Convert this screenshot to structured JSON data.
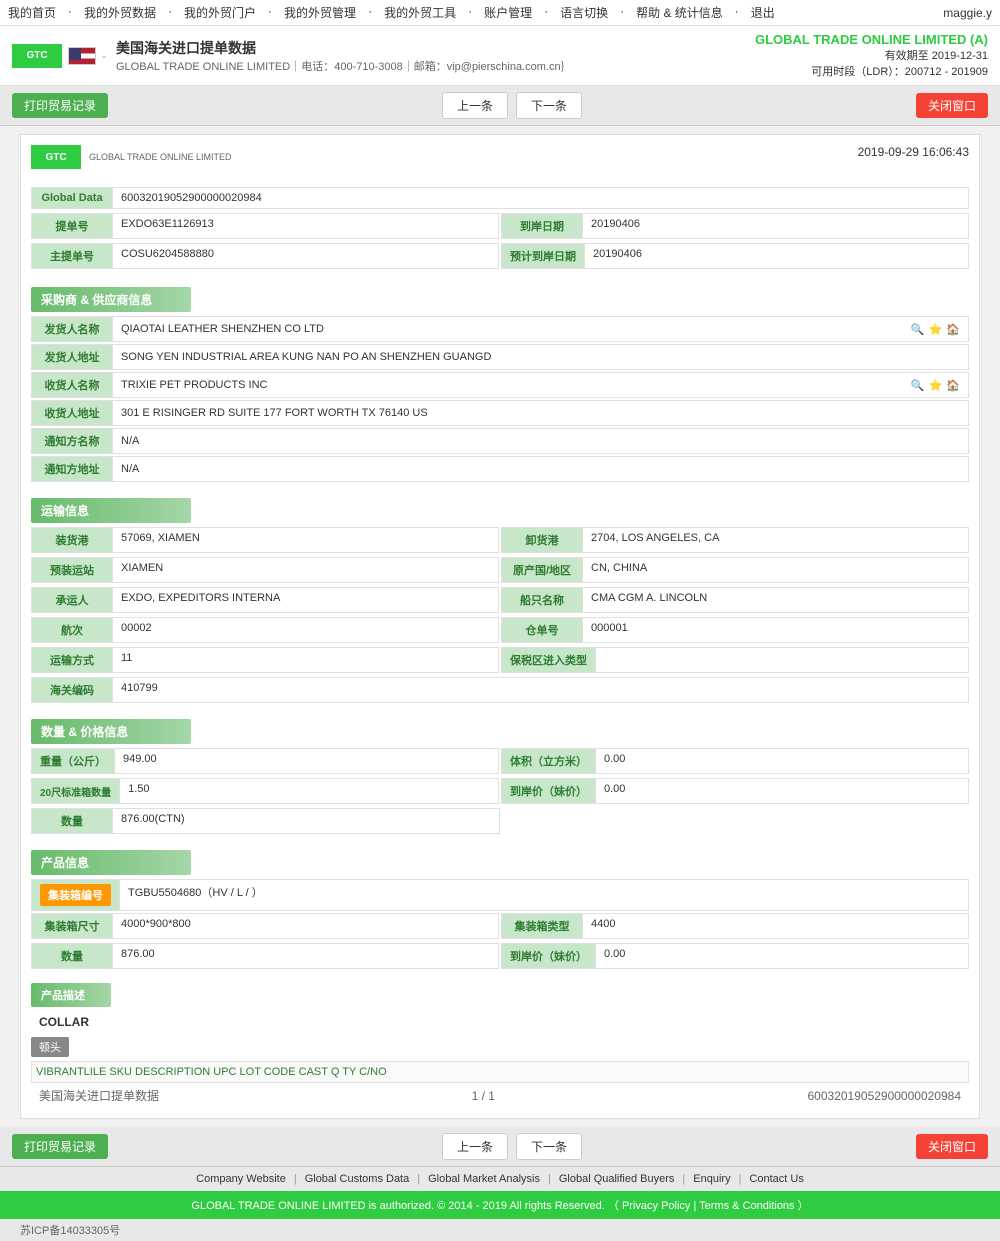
{
  "topnav": {
    "items": [
      "我的首页",
      "我的外贸数据",
      "我的外贸门户",
      "我的外贸管理",
      "我的外贸工具",
      "账户管理",
      "语言切换",
      "帮助 & 统计信息",
      "退出"
    ],
    "user": "maggie.y"
  },
  "header": {
    "title": "美国海关进口提单数据",
    "company_line": "GLOBAL TRADE ONLINE LIMITED｜电话：400-710-3008｜邮箱：vip@pierschina.com.cn｝",
    "brand": "GLOBAL TRADE ONLINE LIMITED (A)",
    "valid_until": "有效期至 2019-12-31",
    "ldr": "可用时段（LDR）：200712 - 201909"
  },
  "toolbar": {
    "print_label": "打印贸易记录",
    "prev_label": "上一条",
    "next_label": "下一条",
    "close_label": "关闭窗口"
  },
  "document": {
    "datetime": "2019-09-29 16:06:43",
    "logo_sub": "GLOBAL TRADE ONLINE LIMITED",
    "global_data_label": "Global Data",
    "global_data_value": "60032019052900000020984",
    "bill_no_label": "提单号",
    "bill_no_value": "EXDO63E1126913",
    "arrival_date_label": "到岸日期",
    "arrival_date_value": "20190406",
    "master_bill_label": "主提单号",
    "master_bill_value": "COSU6204588880",
    "estimated_date_label": "预计到岸日期",
    "estimated_date_value": "20190406"
  },
  "buyer_section": {
    "title": "采购商 & 供应商信息",
    "shipper_name_label": "发货人名称",
    "shipper_name_value": "QIAOTAI LEATHER SHENZHEN CO LTD",
    "shipper_addr_label": "发货人地址",
    "shipper_addr_value": "SONG YEN INDUSTRIAL AREA KUNG NAN PO AN SHENZHEN GUANGD",
    "consignee_name_label": "收货人名称",
    "consignee_name_value": "TRIXIE PET PRODUCTS INC",
    "consignee_addr_label": "收货人地址",
    "consignee_addr_value": "301 E RISINGER RD SUITE 177 FORT WORTH TX 76140 US",
    "notify_name_label": "通知方名称",
    "notify_name_value": "N/A",
    "notify_addr_label": "通知方地址",
    "notify_addr_value": "N/A"
  },
  "transport_section": {
    "title": "运输信息",
    "origin_port_label": "装货港",
    "origin_port_value": "57069, XIAMEN",
    "dest_port_label": "卸货港",
    "dest_port_value": "2704, LOS ANGELES, CA",
    "pre_ship_label": "预装运站",
    "pre_ship_value": "XIAMEN",
    "country_label": "原产国/地区",
    "country_value": "CN, CHINA",
    "carrier_label": "承运人",
    "carrier_value": "EXDO, EXPEDITORS INTERNA",
    "vessel_label": "船只名称",
    "vessel_value": "CMA CGM A. LINCOLN",
    "voyage_label": "航次",
    "voyage_value": "00002",
    "warehouse_label": "仓单号",
    "warehouse_value": "000001",
    "transport_mode_label": "运输方式",
    "transport_mode_value": "11",
    "bonded_label": "保税区进入类型",
    "bonded_value": "",
    "customs_label": "海关编码",
    "customs_value": "410799"
  },
  "quantity_section": {
    "title": "数量 & 价格信息",
    "weight_label": "重量（公斤）",
    "weight_value": "949.00",
    "volume_label": "体积（立方米）",
    "volume_value": "0.00",
    "container20_label": "20尺标准箱数量",
    "container20_value": "1.50",
    "dest_price_label": "到岸价（妹价）",
    "dest_price_value": "0.00",
    "qty_label": "数量",
    "qty_value": "876.00(CTN)"
  },
  "product_section": {
    "title": "产品信息",
    "container_no_label": "集装箱编号",
    "container_no_value": "TGBU5504680（HV / L / ）",
    "container_size_label": "集装箱尺寸",
    "container_size_value": "4000*900*800",
    "container_type_label": "集装箱类型",
    "container_type_value": "4400",
    "qty_label": "数量",
    "qty_value": "876.00",
    "price_label": "到岸价（妹价）",
    "price_value": "0.00",
    "desc_title": "产品描述",
    "desc_value": "COLLAR",
    "end_label": "顿头",
    "table_header": "VIBRANTLILE SKU DESCRIPTION UPC LOT CODE CAST Q TY C/NO"
  },
  "pagination": {
    "source_label": "美国海关进口提单数据",
    "page": "1 / 1",
    "record_id": "60032019052900000020984"
  },
  "footer": {
    "links": [
      "Company Website",
      "Global Customs Data",
      "Global Market Analysis",
      "Global Qualified Buyers",
      "Enquiry",
      "Contact Us"
    ],
    "copyright": "GLOBAL TRADE ONLINE LIMITED is authorized. © 2014 - 2019 All rights Reserved. （ Privacy Policy | Terms & Conditions ）",
    "icp": "苏ICP备14033305号"
  }
}
